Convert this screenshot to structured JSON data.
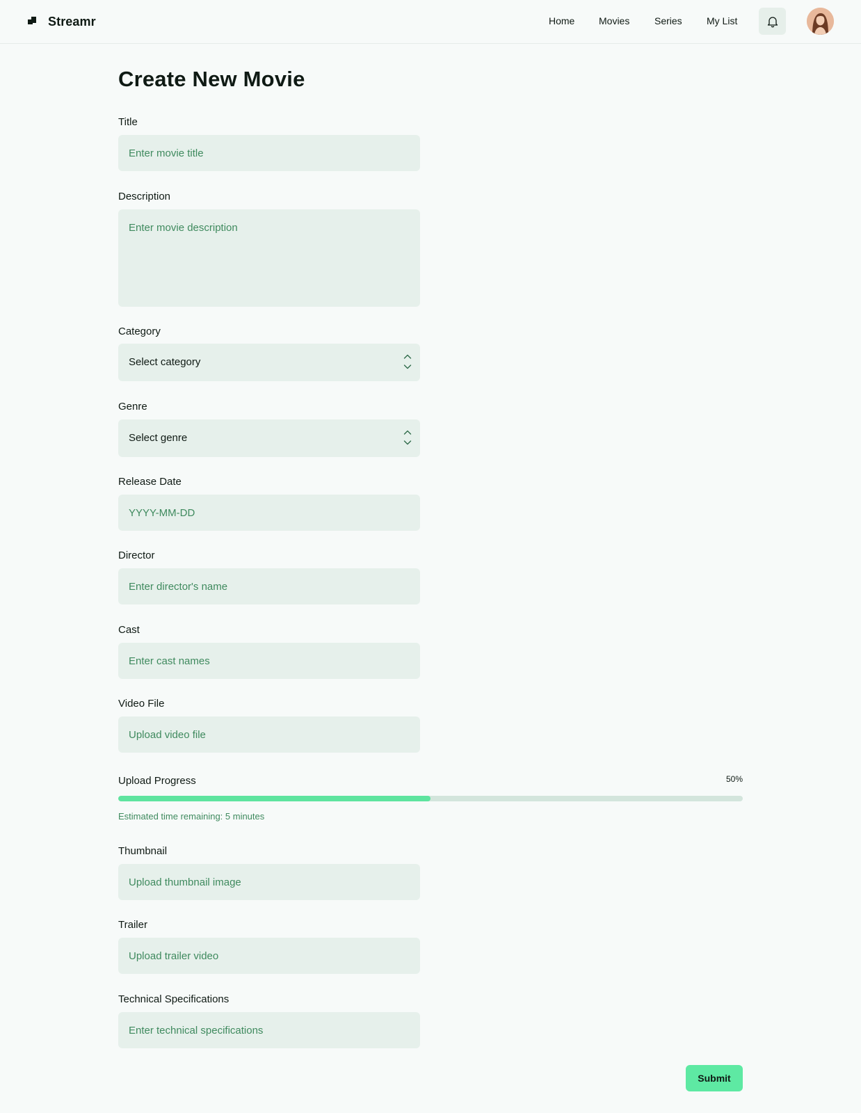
{
  "app": {
    "name": "Streamr"
  },
  "nav": {
    "items": [
      "Home",
      "Movies",
      "Series",
      "My List"
    ]
  },
  "icons": {
    "bell": "bell-icon",
    "logo": "logo-icon",
    "chevron": "chevron-updown-icon"
  },
  "colors": {
    "accent": "#5ee9a3",
    "field_bg": "#e6f0eb",
    "placeholder": "#3f8a5e",
    "page_bg": "#f7faf9"
  },
  "page": {
    "title": "Create New Movie"
  },
  "form": {
    "title": {
      "label": "Title",
      "placeholder": "Enter movie title"
    },
    "description": {
      "label": "Description",
      "placeholder": "Enter movie description"
    },
    "category": {
      "label": "Category",
      "value": "Select category"
    },
    "genre": {
      "label": "Genre",
      "value": "Select genre"
    },
    "release_date": {
      "label": "Release Date",
      "placeholder": "YYYY-MM-DD"
    },
    "director": {
      "label": "Director",
      "placeholder": "Enter director's name"
    },
    "cast": {
      "label": "Cast",
      "placeholder": "Enter cast names"
    },
    "video_file": {
      "label": "Video File",
      "placeholder": "Upload video file"
    },
    "upload": {
      "label": "Upload Progress",
      "percent_text": "50%",
      "percent": 50,
      "note": "Estimated time remaining: 5 minutes"
    },
    "thumbnail": {
      "label": "Thumbnail",
      "placeholder": "Upload thumbnail image"
    },
    "trailer": {
      "label": "Trailer",
      "placeholder": "Upload trailer video"
    },
    "tech_specs": {
      "label": "Technical Specifications",
      "placeholder": "Enter technical specifications"
    },
    "submit_label": "Submit"
  }
}
